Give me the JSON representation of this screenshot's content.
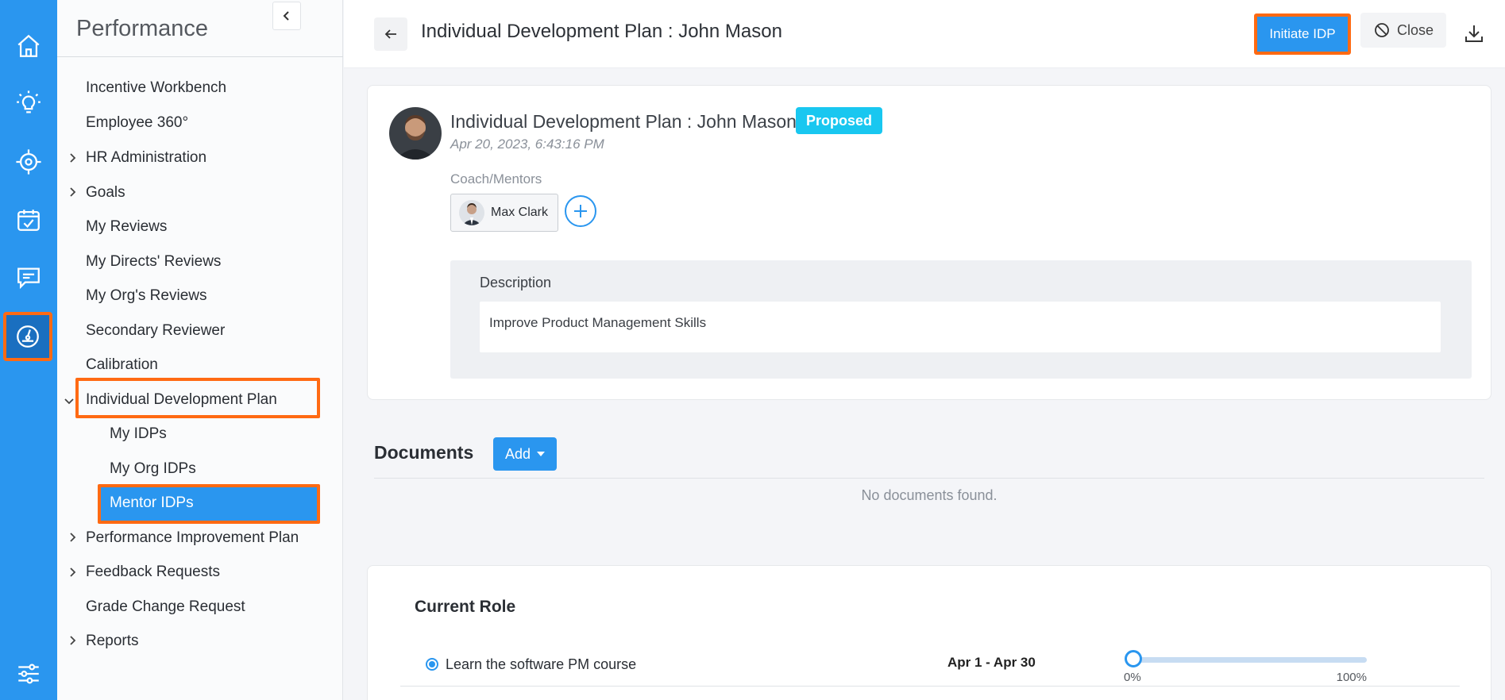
{
  "rail": {
    "items": [
      {
        "icon": "home-icon"
      },
      {
        "icon": "lightbulb-icon"
      },
      {
        "icon": "target-icon"
      },
      {
        "icon": "calendar-check-icon"
      },
      {
        "icon": "chat-icon"
      },
      {
        "icon": "gauge-icon",
        "active": true
      },
      {
        "icon": "sliders-icon"
      }
    ]
  },
  "sidebar": {
    "title": "Performance",
    "items": [
      {
        "label": "Incentive Workbench"
      },
      {
        "label": "Employee 360°"
      },
      {
        "label": "HR Administration",
        "expandable": true
      },
      {
        "label": "Goals",
        "expandable": true
      },
      {
        "label": "My Reviews"
      },
      {
        "label": "My Directs' Reviews"
      },
      {
        "label": "My Org's Reviews"
      },
      {
        "label": "Secondary Reviewer"
      },
      {
        "label": "Calibration"
      },
      {
        "label": "Individual Development Plan",
        "expanded": true
      },
      {
        "label": "My IDPs",
        "sub": true
      },
      {
        "label": "My Org IDPs",
        "sub": true
      },
      {
        "label": "Mentor IDPs",
        "sub": true,
        "selected": true
      },
      {
        "label": "Performance Improvement Plan",
        "expandable": true
      },
      {
        "label": "Feedback Requests",
        "expandable": true
      },
      {
        "label": "Grade Change Request"
      },
      {
        "label": "Reports",
        "expandable": true
      }
    ]
  },
  "header": {
    "title": "Individual Development Plan : John Mason",
    "initiate_label": "Initiate IDP",
    "close_label": "Close"
  },
  "plan": {
    "title": "Individual Development Plan : John Mason",
    "status": "Proposed",
    "date": "Apr 20, 2023, 6:43:16 PM",
    "coach_label": "Coach/Mentors",
    "mentor_name": "Max Clark",
    "description_label": "Description",
    "description": "Improve Product Management Skills"
  },
  "documents": {
    "title": "Documents",
    "add_label": "Add",
    "empty_text": "No documents found."
  },
  "current_role": {
    "title": "Current Role",
    "goals": [
      {
        "text": "Learn the software PM course",
        "dates": "Apr 1 - Apr 30",
        "progress": 0,
        "min_label": "0%",
        "max_label": "100%"
      }
    ]
  },
  "colors": {
    "brand_blue": "#2a96ef",
    "highlight_orange": "#ff6a13",
    "status_cyan": "#19c7f0"
  }
}
